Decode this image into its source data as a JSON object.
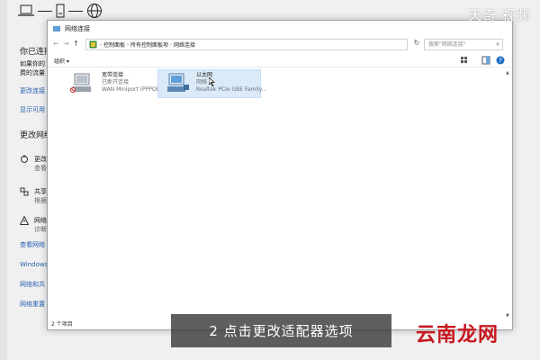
{
  "window": {
    "title": "网络连接",
    "breadcrumbs": [
      "控制面板",
      "所有控制面板项",
      "网络连接"
    ],
    "search_placeholder": "搜索\"网络连接\"",
    "organize_label": "组织 ▾",
    "status": "2 个项目"
  },
  "connections": [
    {
      "name": "宽带连接",
      "status": "已断开连接",
      "device": "WAN Miniport (PPPOE)",
      "selected": false
    },
    {
      "name": "以太网",
      "status": "网络",
      "device": "Realtek PCIe GBE Family...",
      "selected": true
    }
  ],
  "background": {
    "heading1": "你已连接",
    "desc1": "如果你的",
    "desc2": "费的流量",
    "link1": "更改连接",
    "link2": "显示可用",
    "heading2": "更改网络",
    "item1_title": "更改",
    "item1_sub": "查看",
    "item2_title": "共享",
    "item2_sub": "根据",
    "item3_title": "网络",
    "item3_sub": "诊断",
    "link3": "查看网络",
    "link4": "Windows",
    "link5": "网络和共",
    "link6": "网络重置"
  },
  "caption": "2 点击更改适配器选项",
  "watermark_top": "天奇·视频",
  "watermark_bottom": "云南龙网"
}
